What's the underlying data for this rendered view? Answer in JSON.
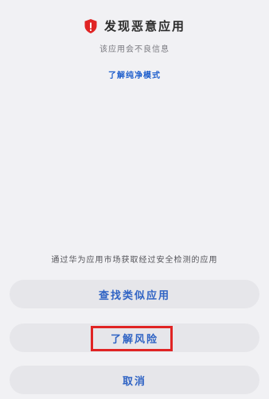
{
  "dialog": {
    "title": "发现恶意应用",
    "subtitle": "该应用会不良信息",
    "learn_more_link": "了解纯净模式",
    "source_note": "通过华为应用市场获取经过安全检测的应用"
  },
  "buttons": {
    "find_similar": "查找类似应用",
    "learn_risk": "了解风险",
    "cancel": "取消"
  },
  "colors": {
    "background": "#f1f1f4",
    "button_bg": "#e6e6ea",
    "accent": "#2f63c4",
    "warning_red": "#e02424"
  },
  "icons": {
    "title_icon": "shield-warning-icon"
  }
}
